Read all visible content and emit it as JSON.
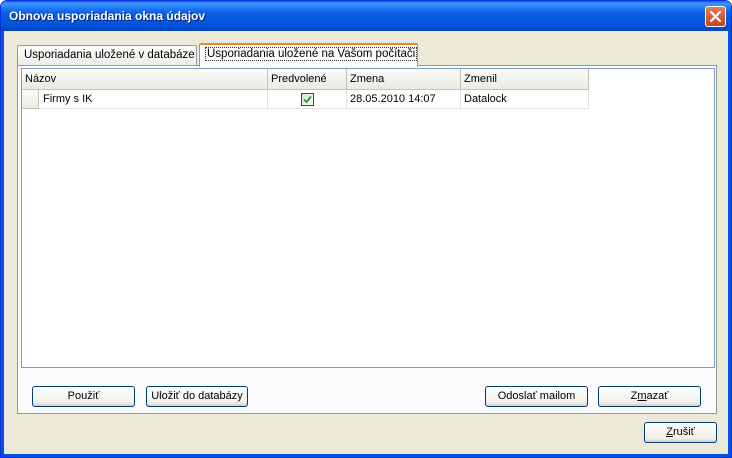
{
  "window": {
    "title": "Obnova usporiadania okna údajov"
  },
  "tabs": [
    {
      "label": "Usporiadania uložené v databáze",
      "active": false
    },
    {
      "label": "Usporiadania uložené na Vašom počítači",
      "active": true
    }
  ],
  "grid": {
    "columns": [
      "Názov",
      "Predvolené",
      "Zmena",
      "Zmenil"
    ],
    "rows": [
      {
        "nazov": "Firmy s IK",
        "predvolene": true,
        "zmena": "28.05.2010 14:07",
        "zmenil": "Datalock"
      }
    ]
  },
  "buttons": {
    "pouzit": "Použiť",
    "ulozit": "Uložiť do databázy",
    "odoslat": "Odoslať mailom",
    "zmazat_pre": "Z",
    "zmazat_u": "m",
    "zmazat_post": "azať",
    "zrusit_u": "Z",
    "zrusit_post": "rušiť"
  },
  "colors": {
    "titlebar": "#0a5fe6",
    "dialog_bg": "#ece9d8",
    "active_tab_accent": "#e68b2c",
    "check": "#21a121"
  },
  "icons": [
    "close-icon",
    "checkbox-checked-icon"
  ]
}
